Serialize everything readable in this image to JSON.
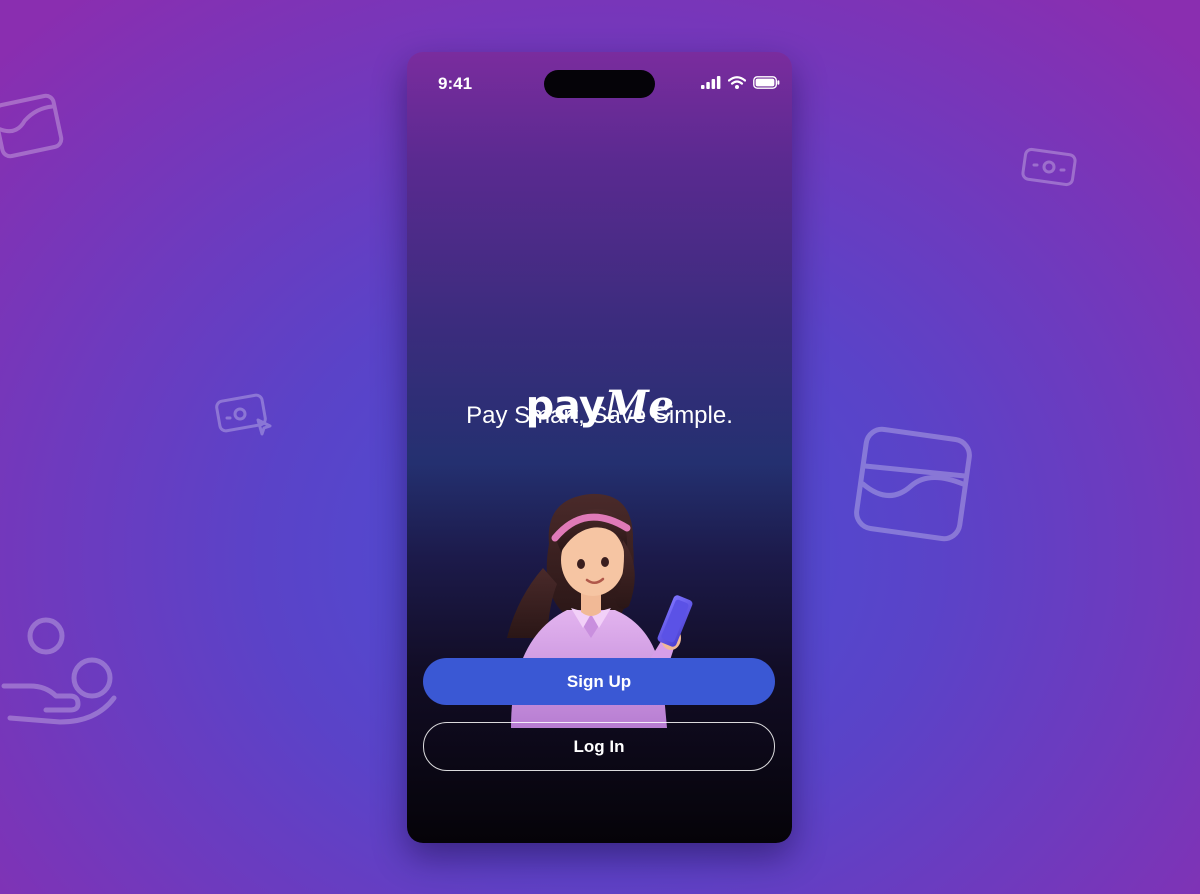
{
  "status_bar": {
    "time": "9:41",
    "icons": [
      "signal-icon",
      "wifi-icon",
      "battery-icon"
    ]
  },
  "brand": {
    "logo_pay": "pay",
    "logo_me": "Me",
    "tagline": "Pay Smart, Save Simple."
  },
  "actions": {
    "signup_label": "Sign Up",
    "login_label": "Log In"
  },
  "illustration": {
    "name": "woman-with-phone-illustration"
  },
  "background_icons": [
    "wallet-icon",
    "cash-icon",
    "cash-cursor-icon",
    "wallet-icon",
    "hand-coin-user-icon"
  ],
  "colors": {
    "background_center": "#4a4fd6",
    "background_edge": "#8a2eb0",
    "primary_button": "#3a58d4",
    "phone_top": "#7a2c9e",
    "phone_bottom": "#050308"
  }
}
